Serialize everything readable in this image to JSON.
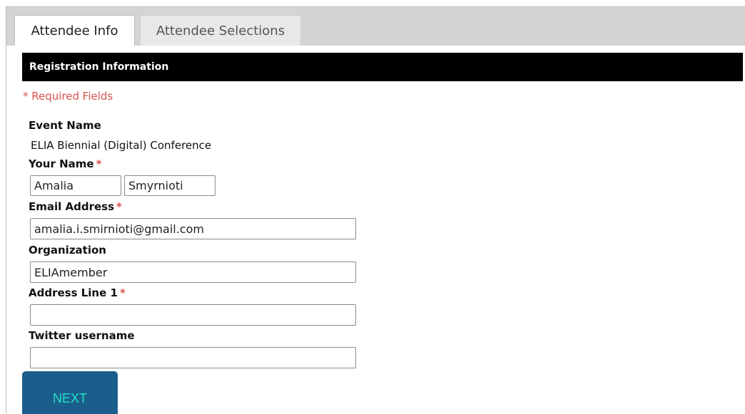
{
  "tabs": [
    {
      "label": "Attendee Info",
      "active": true
    },
    {
      "label": "Attendee Selections",
      "active": false
    }
  ],
  "section": {
    "title": "Registration Information"
  },
  "required_note": "* Required Fields",
  "event": {
    "label": "Event Name",
    "value": "ELIA Biennial (Digital) Conference"
  },
  "name": {
    "label": "Your Name",
    "required_marker": "*",
    "first": "Amalia",
    "last": "Smyrnioti"
  },
  "email": {
    "label": "Email Address",
    "required_marker": "*",
    "value": "amalia.i.smirnioti@gmail.com"
  },
  "organization": {
    "label": "Organization",
    "value": "ELIAmember"
  },
  "address1": {
    "label": "Address Line 1",
    "required_marker": "*",
    "value": ""
  },
  "twitter": {
    "label": "Twitter username",
    "value": ""
  },
  "next_button": {
    "label": "NEXT"
  },
  "colors": {
    "required": "#d9534f",
    "header_bg": "#000000",
    "button_bg": "#1a5e8c",
    "button_text": "#24e0c7",
    "tabbar_bg": "#d4d4d4"
  }
}
